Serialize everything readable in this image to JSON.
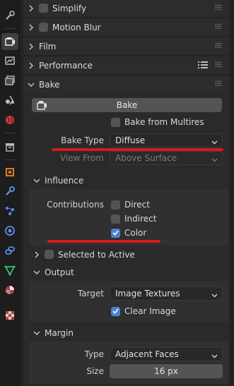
{
  "panels": {
    "simplify": "Simplify",
    "motion_blur": "Motion Blur",
    "film": "Film",
    "performance": "Performance",
    "bake": "Bake"
  },
  "bake": {
    "button": "Bake",
    "bake_from_multires": "Bake from Multires",
    "bake_type_label": "Bake Type",
    "bake_type_value": "Diffuse",
    "view_from_label": "View From",
    "view_from_value": "Above Surface"
  },
  "influence": {
    "title": "Influence",
    "contributions_label": "Contributions",
    "direct": "Direct",
    "indirect": "Indirect",
    "color": "Color"
  },
  "selected_to_active": "Selected to Active",
  "output": {
    "title": "Output",
    "target_label": "Target",
    "target_value": "Image Textures",
    "clear_image": "Clear Image"
  },
  "margin": {
    "title": "Margin",
    "type_label": "Type",
    "type_value": "Adjacent Faces",
    "size_label": "Size",
    "size_value": "16 px"
  },
  "colors": {
    "accent": "#4a82cf",
    "highlight": "#d51a1f"
  },
  "icons": [
    "tool-icon",
    "render-icon",
    "output-icon",
    "view-layer-icon",
    "scene-icon",
    "world-icon",
    "collection-icon",
    "object-icon",
    "modifier-icon",
    "particles-icon",
    "physics-icon",
    "constraints-icon",
    "data-icon",
    "material-icon",
    "texture-icon"
  ]
}
